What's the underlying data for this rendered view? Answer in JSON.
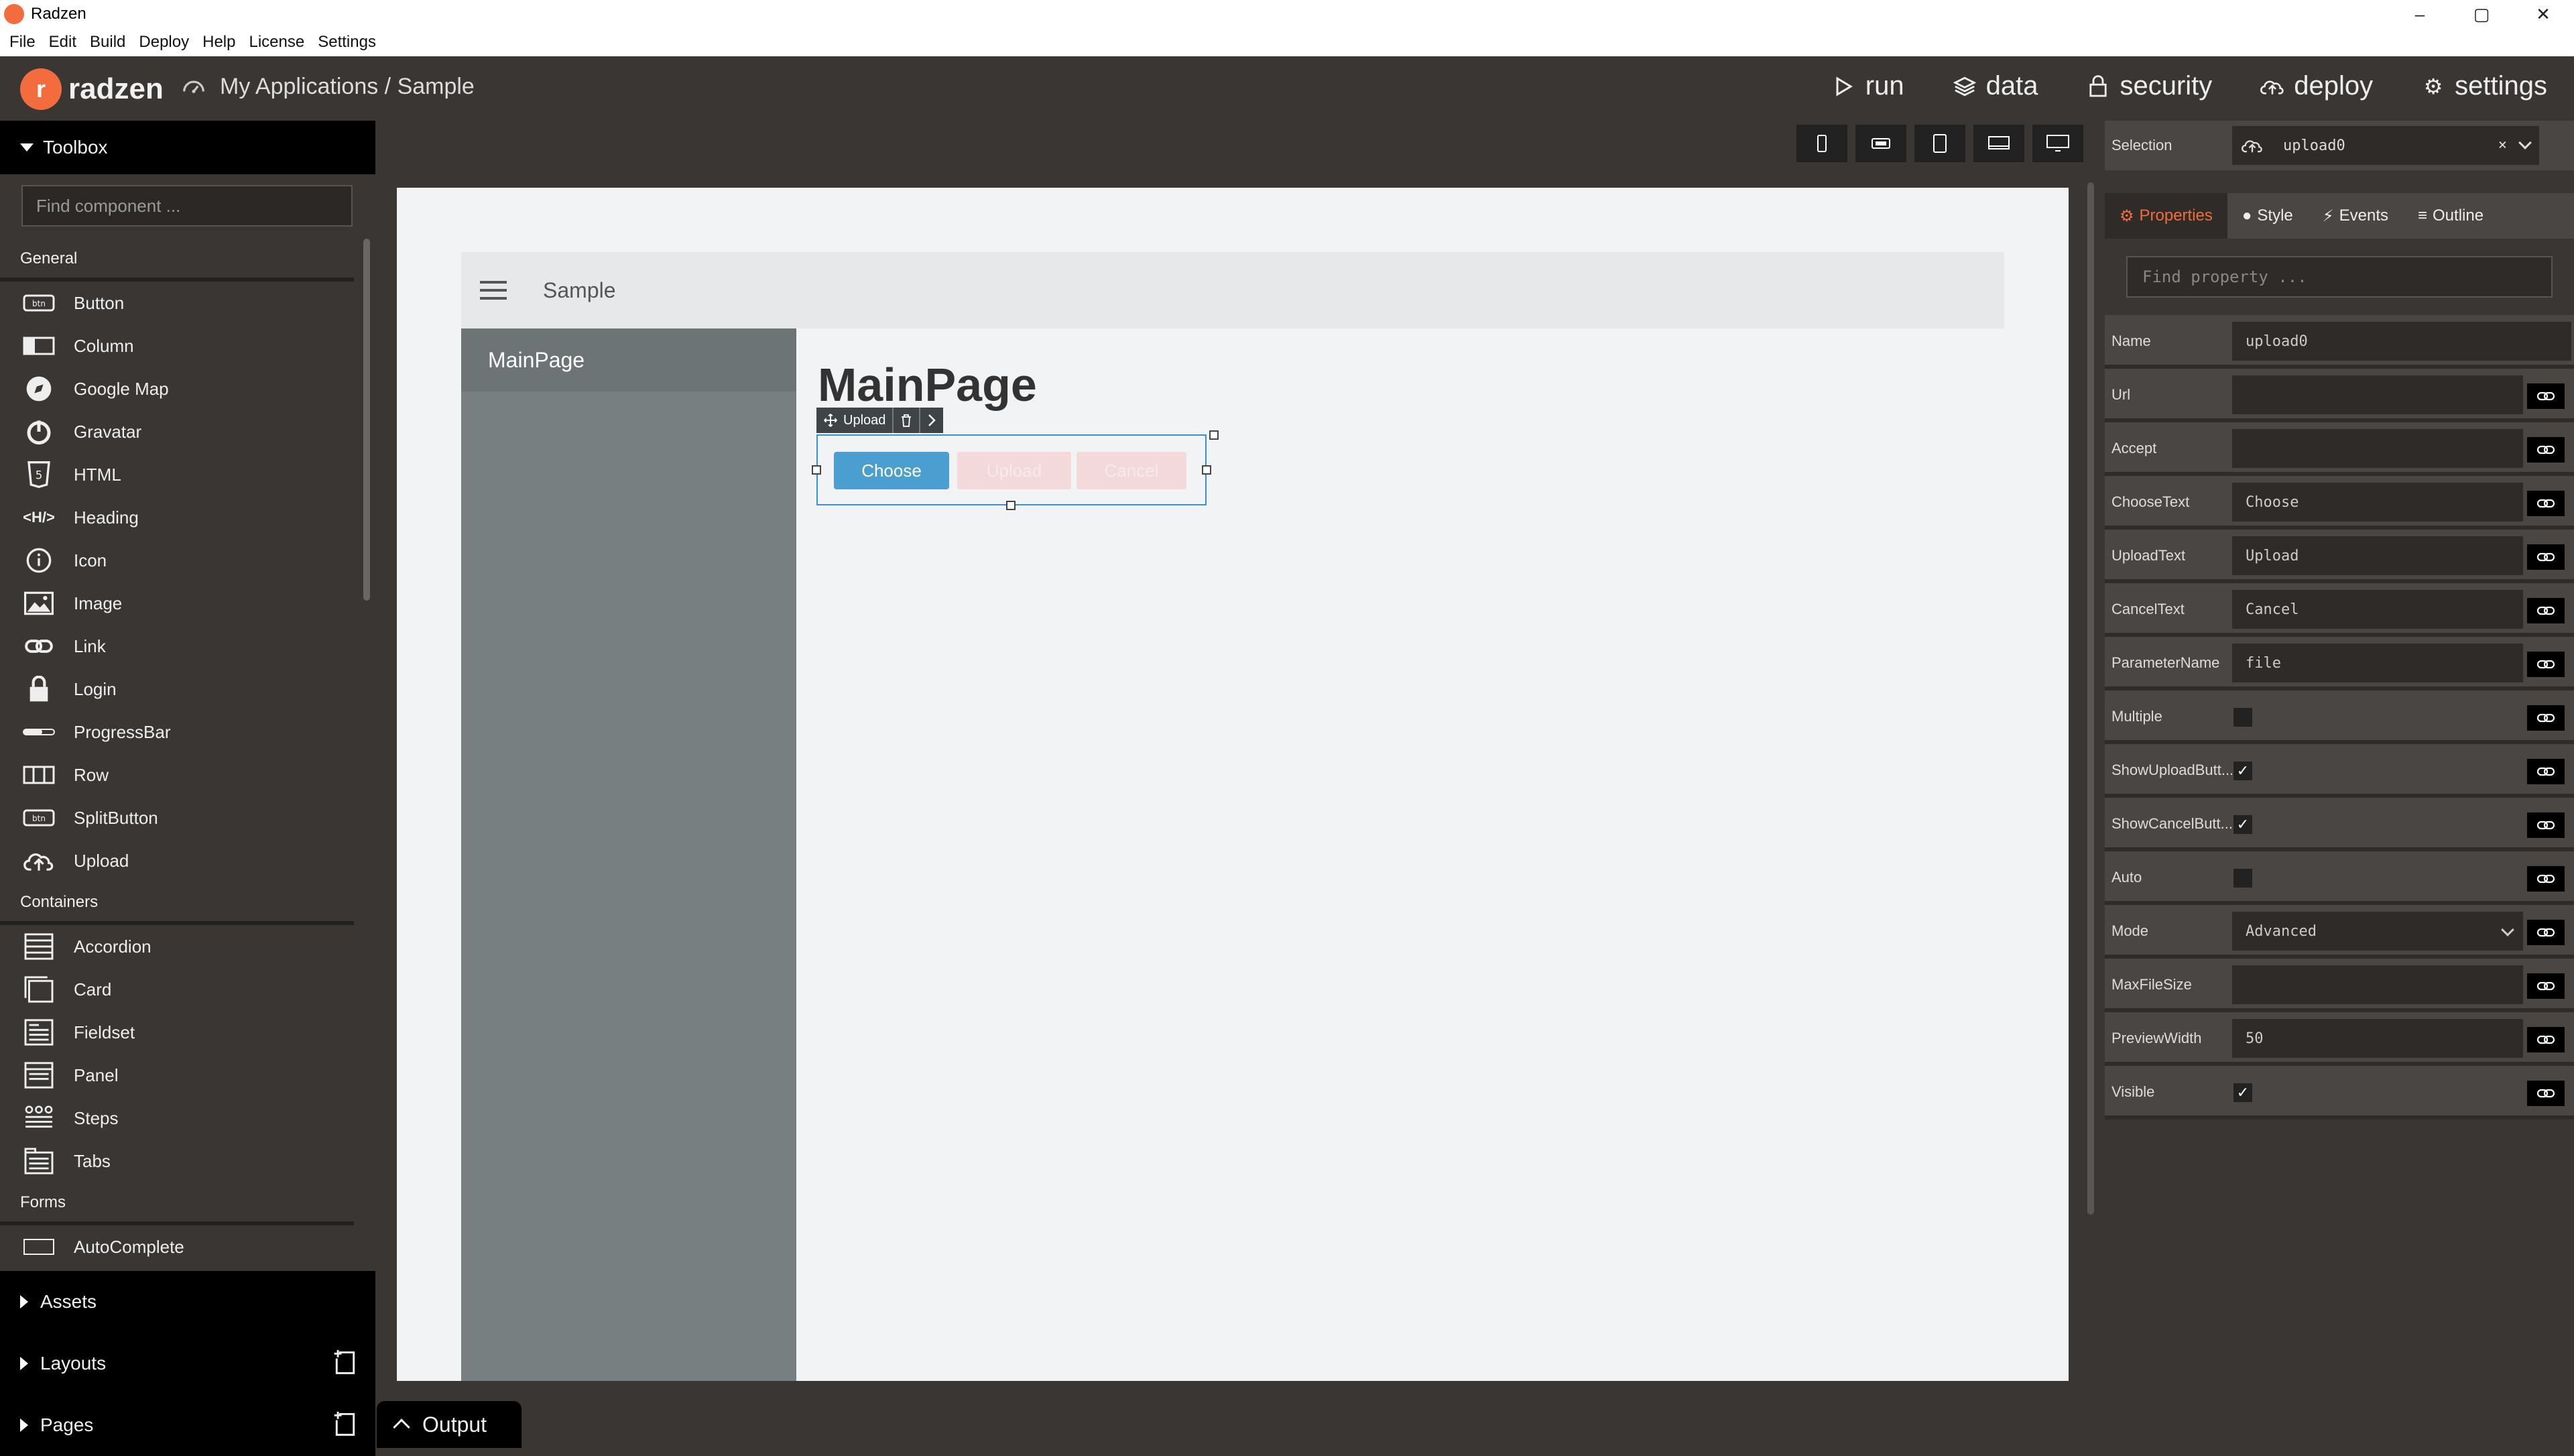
{
  "window": {
    "title": "Radzen",
    "controls": [
      "–",
      "▢",
      "✕"
    ]
  },
  "menu": [
    "File",
    "Edit",
    "Build",
    "Deploy",
    "Help",
    "License",
    "Settings"
  ],
  "header": {
    "brand": "radzen",
    "breadcrumb": "My Applications / Sample",
    "nav": [
      {
        "label": "run",
        "icon": "play-icon"
      },
      {
        "label": "data",
        "icon": "layers-icon"
      },
      {
        "label": "security",
        "icon": "lock-icon"
      },
      {
        "label": "deploy",
        "icon": "cloud-upload-icon"
      },
      {
        "label": "settings",
        "icon": "gear-icon"
      }
    ]
  },
  "toolbox": {
    "title": "Toolbox",
    "search_placeholder": "Find component ...",
    "sections": [
      {
        "name": "General",
        "items": [
          "Button",
          "Column",
          "Google Map",
          "Gravatar",
          "HTML",
          "Heading",
          "Icon",
          "Image",
          "Link",
          "Login",
          "ProgressBar",
          "Row",
          "SplitButton",
          "Upload"
        ]
      },
      {
        "name": "Containers",
        "items": [
          "Accordion",
          "Card",
          "Fieldset",
          "Panel",
          "Steps",
          "Tabs"
        ]
      },
      {
        "name": "Forms",
        "items": [
          "AutoComplete"
        ]
      }
    ],
    "bottom": [
      "Assets",
      "Layouts",
      "Pages"
    ]
  },
  "canvas": {
    "header_title": "Sample",
    "side_item": "MainPage",
    "page_title": "MainPage",
    "selection_toolbar_label": "Upload",
    "buttons": {
      "choose": "Choose",
      "upload": "Upload",
      "cancel": "Cancel"
    }
  },
  "output": {
    "label": "Output"
  },
  "properties": {
    "selection_label": "Selection",
    "selection_value": "upload0",
    "tabs": [
      "Properties",
      "Style",
      "Events",
      "Outline"
    ],
    "search_placeholder": "Find property ...",
    "rows": [
      {
        "name": "Name",
        "type": "text",
        "value": "upload0",
        "link": false
      },
      {
        "name": "Url",
        "type": "text",
        "value": "",
        "link": true
      },
      {
        "name": "Accept",
        "type": "text",
        "value": "",
        "link": true
      },
      {
        "name": "ChooseText",
        "type": "text",
        "value": "Choose",
        "link": true
      },
      {
        "name": "UploadText",
        "type": "text",
        "value": "Upload",
        "link": true
      },
      {
        "name": "CancelText",
        "type": "text",
        "value": "Cancel",
        "link": true
      },
      {
        "name": "ParameterName",
        "type": "text",
        "value": "file",
        "link": true
      },
      {
        "name": "Multiple",
        "type": "check",
        "checked": false,
        "link": true
      },
      {
        "name": "ShowUploadButt...",
        "type": "check",
        "checked": true,
        "link": true
      },
      {
        "name": "ShowCancelButt...",
        "type": "check",
        "checked": true,
        "link": true
      },
      {
        "name": "Auto",
        "type": "check",
        "checked": false,
        "link": true
      },
      {
        "name": "Mode",
        "type": "select",
        "value": "Advanced",
        "link": true
      },
      {
        "name": "MaxFileSize",
        "type": "text",
        "value": "",
        "link": true
      },
      {
        "name": "PreviewWidth",
        "type": "text",
        "value": "50",
        "link": true
      },
      {
        "name": "Visible",
        "type": "check",
        "checked": true,
        "link": true
      }
    ]
  },
  "colors": {
    "brand": "#f36c3d",
    "accent_blue": "#4a9ed0",
    "panel_dark": "#3a3634"
  }
}
